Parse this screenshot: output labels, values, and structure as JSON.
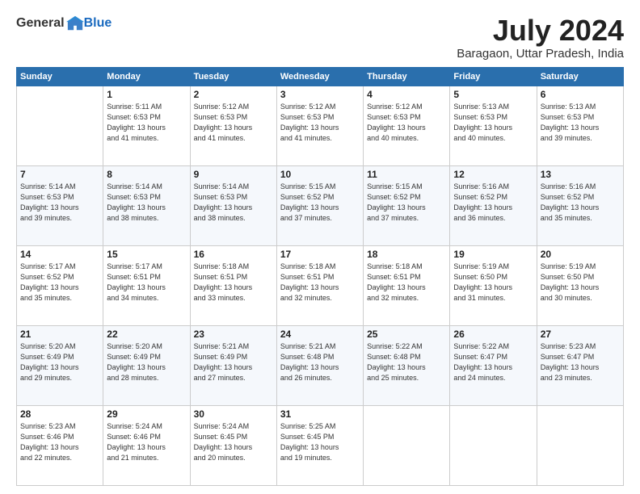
{
  "header": {
    "logo_general": "General",
    "logo_blue": "Blue",
    "title": "July 2024",
    "location": "Baragaon, Uttar Pradesh, India"
  },
  "days_of_week": [
    "Sunday",
    "Monday",
    "Tuesday",
    "Wednesday",
    "Thursday",
    "Friday",
    "Saturday"
  ],
  "weeks": [
    [
      {
        "day": "",
        "info": ""
      },
      {
        "day": "1",
        "info": "Sunrise: 5:11 AM\nSunset: 6:53 PM\nDaylight: 13 hours\nand 41 minutes."
      },
      {
        "day": "2",
        "info": "Sunrise: 5:12 AM\nSunset: 6:53 PM\nDaylight: 13 hours\nand 41 minutes."
      },
      {
        "day": "3",
        "info": "Sunrise: 5:12 AM\nSunset: 6:53 PM\nDaylight: 13 hours\nand 41 minutes."
      },
      {
        "day": "4",
        "info": "Sunrise: 5:12 AM\nSunset: 6:53 PM\nDaylight: 13 hours\nand 40 minutes."
      },
      {
        "day": "5",
        "info": "Sunrise: 5:13 AM\nSunset: 6:53 PM\nDaylight: 13 hours\nand 40 minutes."
      },
      {
        "day": "6",
        "info": "Sunrise: 5:13 AM\nSunset: 6:53 PM\nDaylight: 13 hours\nand 39 minutes."
      }
    ],
    [
      {
        "day": "7",
        "info": "Sunrise: 5:14 AM\nSunset: 6:53 PM\nDaylight: 13 hours\nand 39 minutes."
      },
      {
        "day": "8",
        "info": "Sunrise: 5:14 AM\nSunset: 6:53 PM\nDaylight: 13 hours\nand 38 minutes."
      },
      {
        "day": "9",
        "info": "Sunrise: 5:14 AM\nSunset: 6:53 PM\nDaylight: 13 hours\nand 38 minutes."
      },
      {
        "day": "10",
        "info": "Sunrise: 5:15 AM\nSunset: 6:52 PM\nDaylight: 13 hours\nand 37 minutes."
      },
      {
        "day": "11",
        "info": "Sunrise: 5:15 AM\nSunset: 6:52 PM\nDaylight: 13 hours\nand 37 minutes."
      },
      {
        "day": "12",
        "info": "Sunrise: 5:16 AM\nSunset: 6:52 PM\nDaylight: 13 hours\nand 36 minutes."
      },
      {
        "day": "13",
        "info": "Sunrise: 5:16 AM\nSunset: 6:52 PM\nDaylight: 13 hours\nand 35 minutes."
      }
    ],
    [
      {
        "day": "14",
        "info": "Sunrise: 5:17 AM\nSunset: 6:52 PM\nDaylight: 13 hours\nand 35 minutes."
      },
      {
        "day": "15",
        "info": "Sunrise: 5:17 AM\nSunset: 6:51 PM\nDaylight: 13 hours\nand 34 minutes."
      },
      {
        "day": "16",
        "info": "Sunrise: 5:18 AM\nSunset: 6:51 PM\nDaylight: 13 hours\nand 33 minutes."
      },
      {
        "day": "17",
        "info": "Sunrise: 5:18 AM\nSunset: 6:51 PM\nDaylight: 13 hours\nand 32 minutes."
      },
      {
        "day": "18",
        "info": "Sunrise: 5:18 AM\nSunset: 6:51 PM\nDaylight: 13 hours\nand 32 minutes."
      },
      {
        "day": "19",
        "info": "Sunrise: 5:19 AM\nSunset: 6:50 PM\nDaylight: 13 hours\nand 31 minutes."
      },
      {
        "day": "20",
        "info": "Sunrise: 5:19 AM\nSunset: 6:50 PM\nDaylight: 13 hours\nand 30 minutes."
      }
    ],
    [
      {
        "day": "21",
        "info": "Sunrise: 5:20 AM\nSunset: 6:49 PM\nDaylight: 13 hours\nand 29 minutes."
      },
      {
        "day": "22",
        "info": "Sunrise: 5:20 AM\nSunset: 6:49 PM\nDaylight: 13 hours\nand 28 minutes."
      },
      {
        "day": "23",
        "info": "Sunrise: 5:21 AM\nSunset: 6:49 PM\nDaylight: 13 hours\nand 27 minutes."
      },
      {
        "day": "24",
        "info": "Sunrise: 5:21 AM\nSunset: 6:48 PM\nDaylight: 13 hours\nand 26 minutes."
      },
      {
        "day": "25",
        "info": "Sunrise: 5:22 AM\nSunset: 6:48 PM\nDaylight: 13 hours\nand 25 minutes."
      },
      {
        "day": "26",
        "info": "Sunrise: 5:22 AM\nSunset: 6:47 PM\nDaylight: 13 hours\nand 24 minutes."
      },
      {
        "day": "27",
        "info": "Sunrise: 5:23 AM\nSunset: 6:47 PM\nDaylight: 13 hours\nand 23 minutes."
      }
    ],
    [
      {
        "day": "28",
        "info": "Sunrise: 5:23 AM\nSunset: 6:46 PM\nDaylight: 13 hours\nand 22 minutes."
      },
      {
        "day": "29",
        "info": "Sunrise: 5:24 AM\nSunset: 6:46 PM\nDaylight: 13 hours\nand 21 minutes."
      },
      {
        "day": "30",
        "info": "Sunrise: 5:24 AM\nSunset: 6:45 PM\nDaylight: 13 hours\nand 20 minutes."
      },
      {
        "day": "31",
        "info": "Sunrise: 5:25 AM\nSunset: 6:45 PM\nDaylight: 13 hours\nand 19 minutes."
      },
      {
        "day": "",
        "info": ""
      },
      {
        "day": "",
        "info": ""
      },
      {
        "day": "",
        "info": ""
      }
    ]
  ]
}
